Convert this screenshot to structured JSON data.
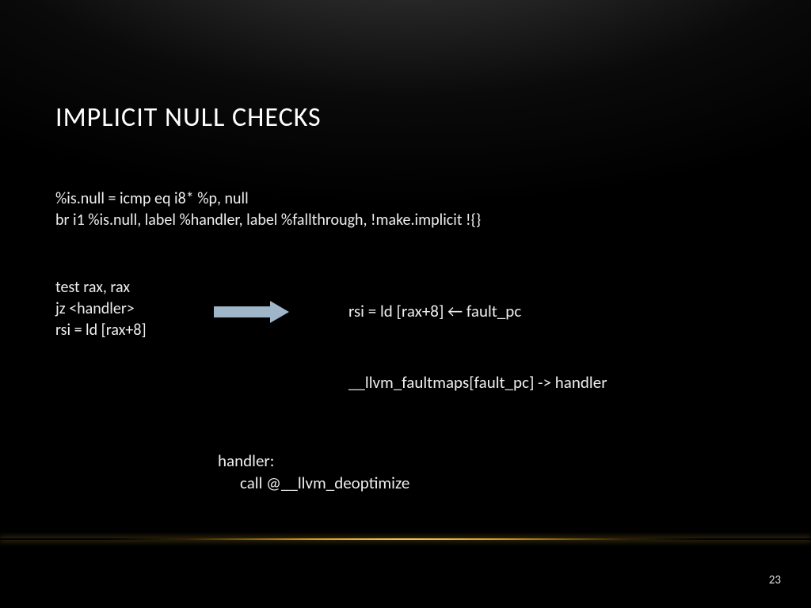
{
  "title": "IMPLICIT NULL CHECKS",
  "ir": {
    "line1": "%is.null = icmp eq i8* %p, null",
    "line2": "br i1 %is.null, label %handler, label %fallthrough, !make.implicit !{}"
  },
  "asm_left": {
    "line1": "test rax, rax",
    "line2": "jz <handler>",
    "line3": "rsi = ld [rax+8]"
  },
  "asm_right": "rsi = ld [rax+8]   ← fault_pc",
  "faultmap": "__llvm_faultmaps[fault_pc] -> handler",
  "handler": {
    "label": "handler:",
    "body": "call @__llvm_deoptimize"
  },
  "page_number": "23"
}
